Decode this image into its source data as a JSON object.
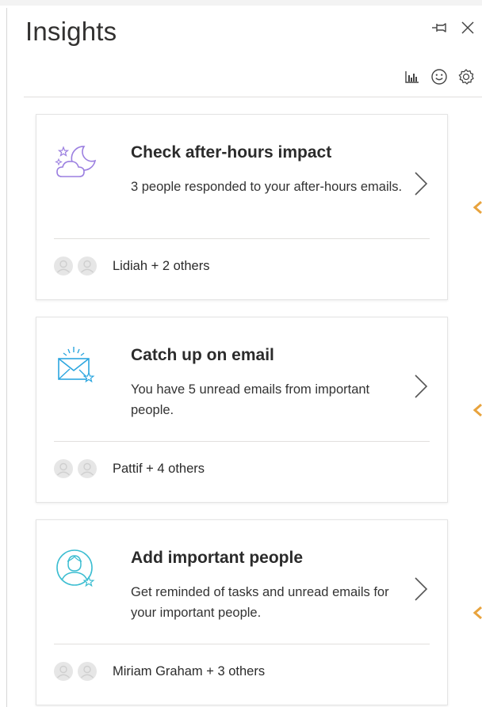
{
  "pane": {
    "title": "Insights",
    "controls": [
      {
        "name": "pin-icon"
      },
      {
        "name": "close-icon"
      }
    ],
    "toolbar": [
      {
        "name": "chart-icon"
      },
      {
        "name": "smiley-icon"
      },
      {
        "name": "settings-icon"
      }
    ]
  },
  "cards": [
    {
      "icon": "night-moon-icon",
      "title": "Check after-hours impact",
      "description": "3 people responded to your after-hours emails.",
      "people": "Lidiah + 2 others"
    },
    {
      "icon": "email-icon",
      "title": "Catch up on email",
      "description": "You have 5 unread emails from important people.",
      "people": "Pattif + 4 others"
    },
    {
      "icon": "person-star-icon",
      "title": "Add important people",
      "description": "Get reminded of tasks and unread emails for your important people.",
      "people": "Miriam Graham + 3 others"
    }
  ],
  "colors": {
    "accent_orange": "#e8a33d",
    "moon_purple": "#9b7fe0",
    "icon_blue": "#2ca6df",
    "person_teal": "#3bbdd1"
  }
}
